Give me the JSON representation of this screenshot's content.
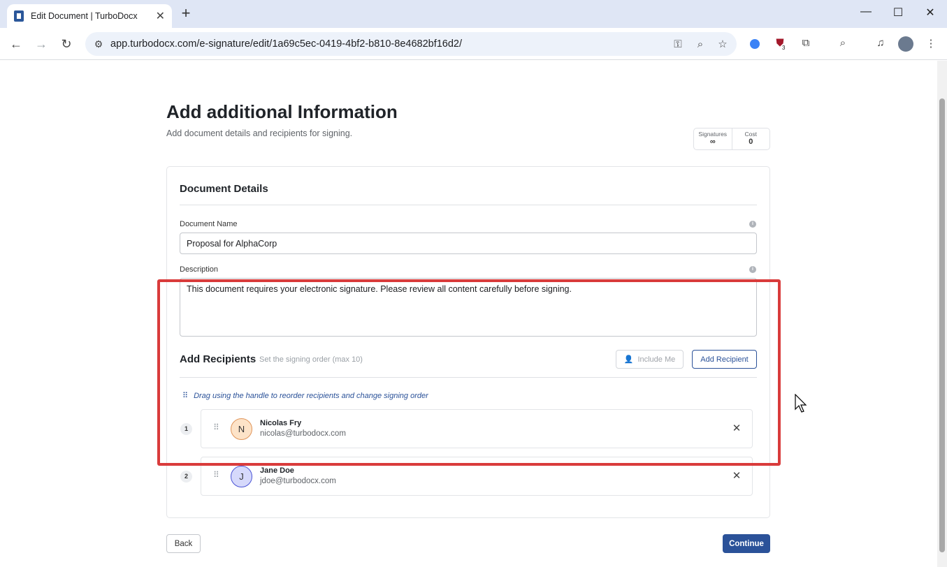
{
  "browser": {
    "tab_title": "Edit Document | TurboDocx",
    "url": "app.turbodocx.com/e-signature/edit/1a69c5ec-0419-4bf2-b810-8e4682bf16d2/",
    "extension_badge": "3"
  },
  "page": {
    "title": "Add additional Information",
    "subtitle": "Add document details and recipients for signing.",
    "stats": {
      "signatures_label": "Signatures",
      "signatures_value": "∞",
      "cost_label": "Cost",
      "cost_value": "0"
    }
  },
  "document_details": {
    "title": "Document Details",
    "name_label": "Document Name",
    "name_value": "Proposal for AlphaCorp",
    "description_label": "Description",
    "description_value": "This document requires your electronic signature. Please review all content carefully before signing."
  },
  "recipients": {
    "title": "Add Recipients",
    "subtitle": "Set the signing order (max 10)",
    "include_me_label": "Include Me",
    "add_recipient_label": "Add Recipient",
    "drag_hint": "Drag using the handle to reorder recipients and change signing order",
    "items": [
      {
        "order": "1",
        "initial": "N",
        "name": "Nicolas Fry",
        "email": "nicolas@turbodocx.com",
        "avatar_bg": "#fde3c8",
        "avatar_border": "#e0955a"
      },
      {
        "order": "2",
        "initial": "J",
        "name": "Jane Doe",
        "email": "jdoe@turbodocx.com",
        "avatar_bg": "#d6d9fb",
        "avatar_border": "#4b55d6"
      }
    ]
  },
  "footer": {
    "back_label": "Back",
    "continue_label": "Continue"
  },
  "colors": {
    "primary": "#2b5299",
    "highlight": "#d93b3b"
  }
}
